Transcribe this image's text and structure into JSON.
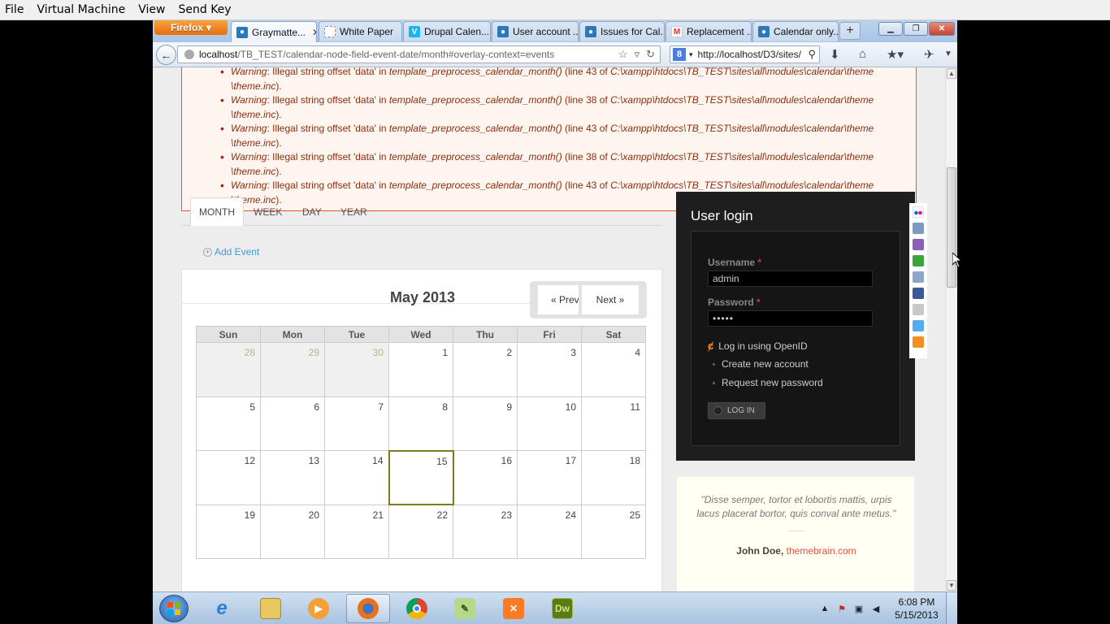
{
  "vm_menu": [
    "File",
    "Virtual Machine",
    "View",
    "Send Key"
  ],
  "browser": {
    "app_button": "Firefox",
    "tabs": [
      {
        "label": "Graymatte...",
        "icon": "drupal-icon",
        "active": true
      },
      {
        "label": "White Paper",
        "icon": "page-icon"
      },
      {
        "label": "Drupal Calen...",
        "icon": "vimeo-icon"
      },
      {
        "label": "User account ...",
        "icon": "drupal-icon"
      },
      {
        "label": "Issues for Cal...",
        "icon": "drupal-icon"
      },
      {
        "label": "Replacement ...",
        "icon": "gmail-icon"
      },
      {
        "label": "Calendar only...",
        "icon": "drupal-icon"
      }
    ],
    "url_host": "localhost",
    "url_path": "/TB_TEST/calendar-node-field-event-date/month#overlay-context=events",
    "search_value": "http://localhost/D3/sites/"
  },
  "errors": {
    "partial_first": {
      "label": "Warning",
      "text_a": ": Illegal string offset 'data' in ",
      "func": "template_preprocess_calendar_month()",
      "text_b": " (line 43 of ",
      "path": "C:\\xampp\\htdocs\\TB_TEST\\sites\\all\\modules\\calendar\\theme",
      "tail": "\\theme.inc",
      "end": ")."
    },
    "items": [
      {
        "label": "Warning",
        "text_a": ": Illegal string offset 'data' in ",
        "func": "template_preprocess_calendar_month()",
        "text_b": " (line 38 of ",
        "path": "C:\\xampp\\htdocs\\TB_TEST\\sites\\all\\modules\\calendar\\theme",
        "tail": "\\theme.inc",
        "end": ")."
      },
      {
        "label": "Warning",
        "text_a": ": Illegal string offset 'data' in ",
        "func": "template_preprocess_calendar_month()",
        "text_b": " (line 43 of ",
        "path": "C:\\xampp\\htdocs\\TB_TEST\\sites\\all\\modules\\calendar\\theme",
        "tail": "\\theme.inc",
        "end": ")."
      },
      {
        "label": "Warning",
        "text_a": ": Illegal string offset 'data' in ",
        "func": "template_preprocess_calendar_month()",
        "text_b": " (line 38 of ",
        "path": "C:\\xampp\\htdocs\\TB_TEST\\sites\\all\\modules\\calendar\\theme",
        "tail": "\\theme.inc",
        "end": ")."
      },
      {
        "label": "Warning",
        "text_a": ": Illegal string offset 'data' in ",
        "func": "template_preprocess_calendar_month()",
        "text_b": " (line 43 of ",
        "path": "C:\\xampp\\htdocs\\TB_TEST\\sites\\all\\modules\\calendar\\theme",
        "tail": "\\theme.inc",
        "end": ")."
      }
    ]
  },
  "calendar": {
    "tabs": [
      "MONTH",
      "WEEK",
      "DAY",
      "YEAR"
    ],
    "active_tab": "MONTH",
    "add_event": "Add Event",
    "title": "May 2013",
    "prev": "« Prev",
    "next": "Next »",
    "weekdays": [
      "Sun",
      "Mon",
      "Tue",
      "Wed",
      "Thu",
      "Fri",
      "Sat"
    ],
    "weeks": [
      [
        "28",
        "29",
        "30",
        "1",
        "2",
        "3",
        "4"
      ],
      [
        "5",
        "6",
        "7",
        "8",
        "9",
        "10",
        "11"
      ],
      [
        "12",
        "13",
        "14",
        "15",
        "16",
        "17",
        "18"
      ],
      [
        "19",
        "20",
        "21",
        "22",
        "23",
        "24",
        "25"
      ]
    ],
    "other_month_count": 3,
    "today": "15"
  },
  "login": {
    "title": "User login",
    "username_label": "Username",
    "username_value": "admin",
    "password_label": "Password",
    "password_value": "•••••",
    "required_mark": "*",
    "openid_link": "Log in using OpenID",
    "create_account": "Create new account",
    "request_password": "Request new password",
    "submit": "LOG IN"
  },
  "quote": {
    "text": "\"Disse semper, tortor et lobortis mattis, urpis lacus placerat bortor, quis conval ante metus.\"",
    "author": "John Doe, ",
    "site": "themebrain.com"
  },
  "taskbar": {
    "time": "6:08 PM",
    "date": "5/15/2013",
    "apps": [
      "internet-explorer",
      "file-explorer",
      "media-player",
      "firefox",
      "chrome",
      "notepad-plus",
      "xampp",
      "dreamweaver"
    ],
    "dreamweaver_label": "Dw"
  },
  "colors": {
    "error_border": "#ed541d",
    "error_text": "#8c2e0b",
    "link": "#3e9ad8",
    "today_border": "#7c7c1c",
    "login_bg": "#1e1e1e",
    "quote_site": "#e0533b"
  }
}
